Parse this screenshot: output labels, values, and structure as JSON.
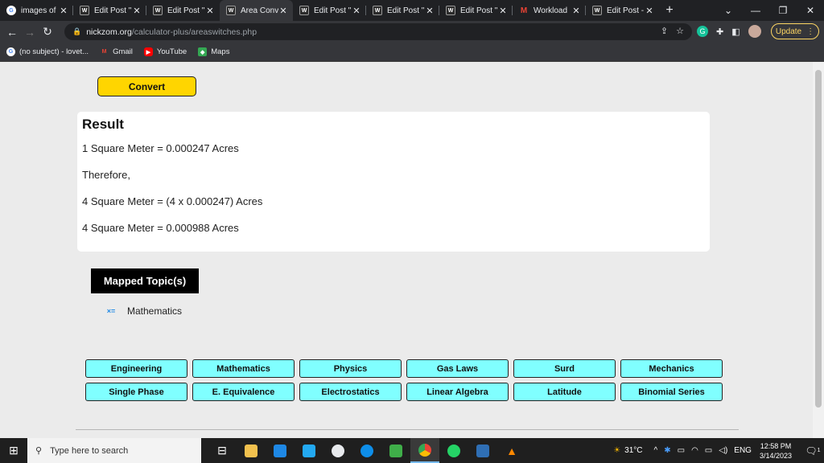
{
  "browser": {
    "tabs": [
      {
        "label": "images of",
        "favicon": "google-icon",
        "active": false
      },
      {
        "label": "Edit Post \"",
        "favicon": "wp-icon",
        "active": false
      },
      {
        "label": "Edit Post \"",
        "favicon": "wp-icon",
        "active": false
      },
      {
        "label": "Area Conv",
        "favicon": "wp-icon",
        "active": true
      },
      {
        "label": "Edit Post \"",
        "favicon": "wp-icon",
        "active": false
      },
      {
        "label": "Edit Post \"",
        "favicon": "wp-icon",
        "active": false
      },
      {
        "label": "Edit Post \"",
        "favicon": "wp-icon",
        "active": false
      },
      {
        "label": "Workload",
        "favicon": "gmail-icon",
        "active": false
      },
      {
        "label": "Edit Post -",
        "favicon": "wp-icon",
        "active": false
      }
    ],
    "new_tab": "+",
    "url_domain": "nickzom.org",
    "url_path": "/calculator-plus/areaswitches.php",
    "update_label": "Update",
    "bookmarks": [
      {
        "label": "(no subject) - lovet...",
        "icon": "google-icon"
      },
      {
        "label": "Gmail",
        "icon": "gmail-icon"
      },
      {
        "label": "YouTube",
        "icon": "youtube-icon"
      },
      {
        "label": "Maps",
        "icon": "maps-icon"
      }
    ]
  },
  "page": {
    "convert_label": "Convert",
    "result": {
      "title": "Result",
      "lines": [
        "1 Square Meter = 0.000247 Acres",
        "Therefore,",
        "4 Square Meter = (4 x 0.000247) Acres",
        "4 Square Meter = 0.000988 Acres"
      ]
    },
    "mapped_title": "Mapped Topic(s)",
    "topic": "Mathematics",
    "tags": [
      "Engineering",
      "Mathematics",
      "Physics",
      "Gas Laws",
      "Surd",
      "Mechanics",
      "Single Phase",
      "E. Equivalence",
      "Electrostatics",
      "Linear Algebra",
      "Latitude",
      "Binomial Series"
    ],
    "colors": {
      "convert_bg": "#ffd500",
      "tag_bg": "#80ffff"
    }
  },
  "taskbar": {
    "search_placeholder": "Type here to search",
    "weather": "31°C",
    "language": "ENG",
    "time": "12:58 PM",
    "date": "3/14/2023",
    "notif_count": "1"
  }
}
